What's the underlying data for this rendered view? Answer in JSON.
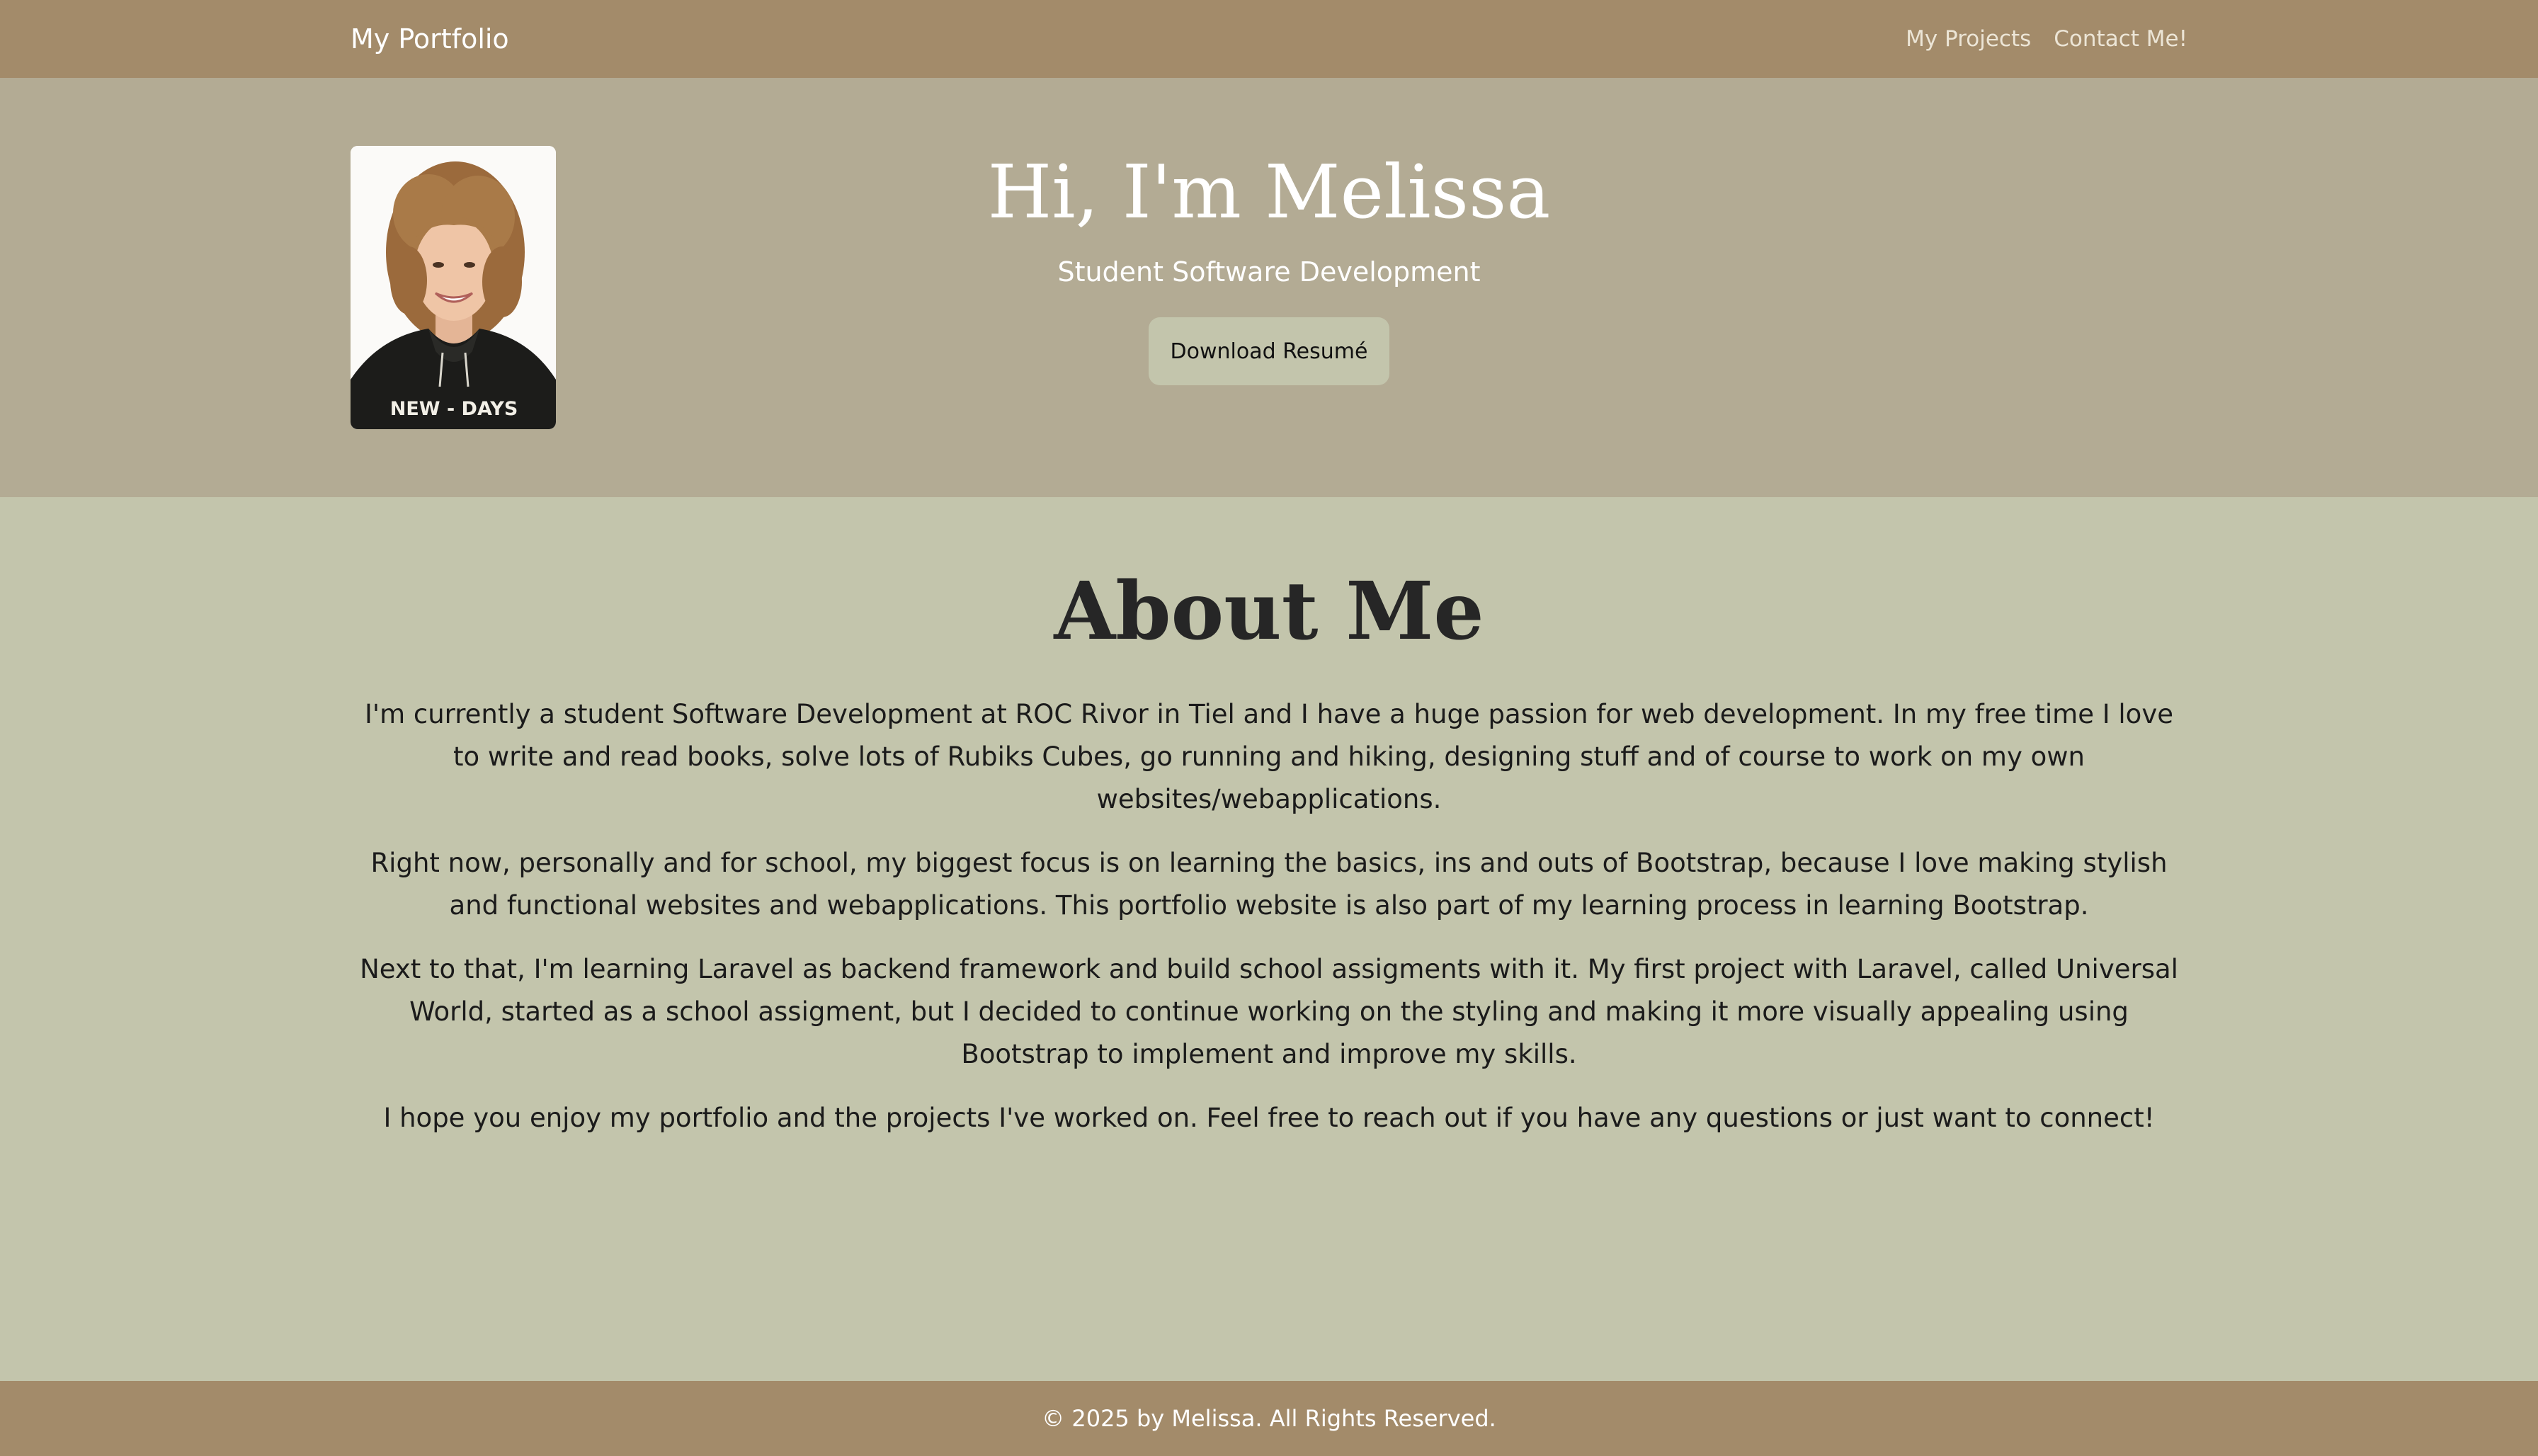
{
  "navbar": {
    "brand": "My Portfolio",
    "links": [
      {
        "label": "My Projects"
      },
      {
        "label": "Contact Me!"
      }
    ]
  },
  "hero": {
    "title": "Hi, I'm Melissa",
    "subtitle": "Student Software Development",
    "button_label": "Download Resumé",
    "portrait_shirt_text": "NEW - DAYS"
  },
  "about": {
    "title": "About Me",
    "paragraphs": [
      "I'm currently a student Software Development at ROC Rivor in Tiel and I have a huge passion for web development. In my free time I love to write and read books, solve lots of Rubiks Cubes, go running and hiking, designing stuff and of course to work on my own websites/webapplications.",
      "Right now, personally and for school, my biggest focus is on learning the basics, ins and outs of Bootstrap, because I love making stylish and functional websites and webapplications. This portfolio website is also part of my learning process in learning Bootstrap.",
      "Next to that, I'm learning Laravel as backend framework and build school assigments with it. My first project with Laravel, called Universal World, started as a school assigment, but I decided to continue working on the styling and making it more visually appealing using Bootstrap to implement and improve my skills.",
      "I hope you enjoy my portfolio and the projects I've worked on. Feel free to reach out if you have any questions or just want to connect!"
    ]
  },
  "footer": {
    "text": "© 2025 by Melissa. All Rights Reserved."
  },
  "colors": {
    "navbar": "#a38b6a",
    "hero": "#b3ab94",
    "about": "#c3c5ac",
    "footer": "#a38b6a",
    "button": "#c3c5ac"
  }
}
